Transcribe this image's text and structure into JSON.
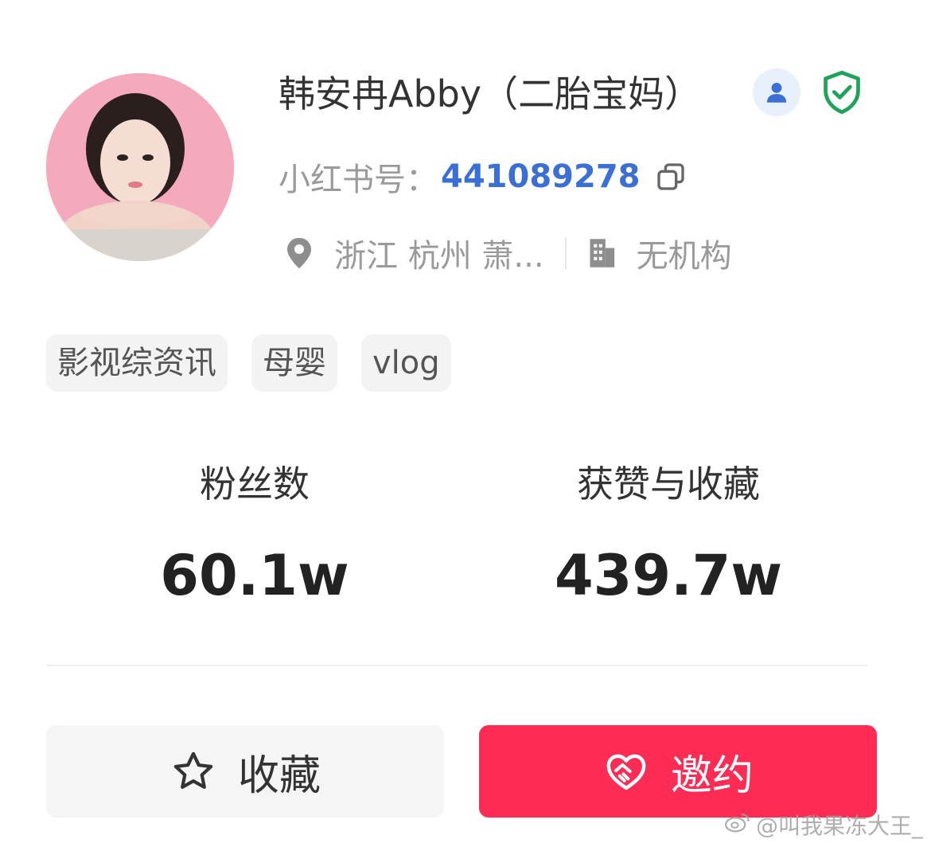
{
  "profile": {
    "name": "韩安冉Abby（二胎宝妈）",
    "id_label": "小红书号：",
    "id_value": "441089278",
    "location": "浙江 杭州 萧...",
    "organization": "无机构"
  },
  "tags": [
    "影视综资讯",
    "母婴",
    "vlog"
  ],
  "stats": {
    "fans_label": "粉丝数",
    "fans_value": "60.1w",
    "likes_label": "获赞与收藏",
    "likes_value": "439.7w"
  },
  "actions": {
    "collect_label": "收藏",
    "invite_label": "邀约"
  },
  "watermark": "@叫我果冻大王_",
  "colors": {
    "accent_blue": "#3a6fd6",
    "verified_green": "#1fa35a",
    "invite_red": "#fe2c55"
  },
  "icons": [
    "person-icon",
    "verified-shield-icon",
    "copy-icon",
    "location-pin-icon",
    "building-icon",
    "star-icon",
    "handshake-heart-icon",
    "weibo-icon"
  ]
}
